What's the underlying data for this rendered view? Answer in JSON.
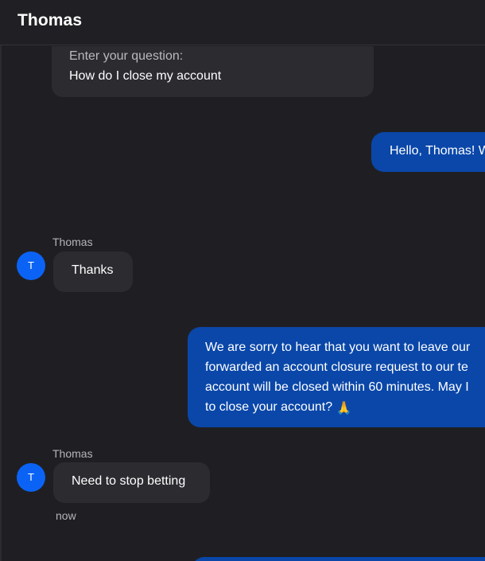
{
  "header": {
    "title": "Thomas"
  },
  "form_card": {
    "label": "Enter your question:",
    "value": "How do I close my account"
  },
  "messages": [
    {
      "direction": "outgoing",
      "text": "Hello, Thomas! W"
    },
    {
      "direction": "incoming",
      "sender": "Thomas",
      "avatar_initial": "T",
      "text": "Thanks"
    },
    {
      "direction": "outgoing",
      "lines": [
        "We are sorry to hear that you want to leave our",
        "forwarded an account closure request to our te",
        "account will be closed within 60 minutes. May I",
        "to close your account?"
      ],
      "emoji": "🙏"
    },
    {
      "direction": "incoming",
      "sender": "Thomas",
      "avatar_initial": "T",
      "text": "Need to stop betting",
      "timestamp": "now"
    }
  ],
  "colors": {
    "background": "#1f1f23",
    "header_background": "#202024",
    "incoming_bubble": "#2b2b30",
    "outgoing_bubble": "#0a47a9",
    "avatar": "#0b63f6",
    "muted_text": "#b4b4b9"
  }
}
